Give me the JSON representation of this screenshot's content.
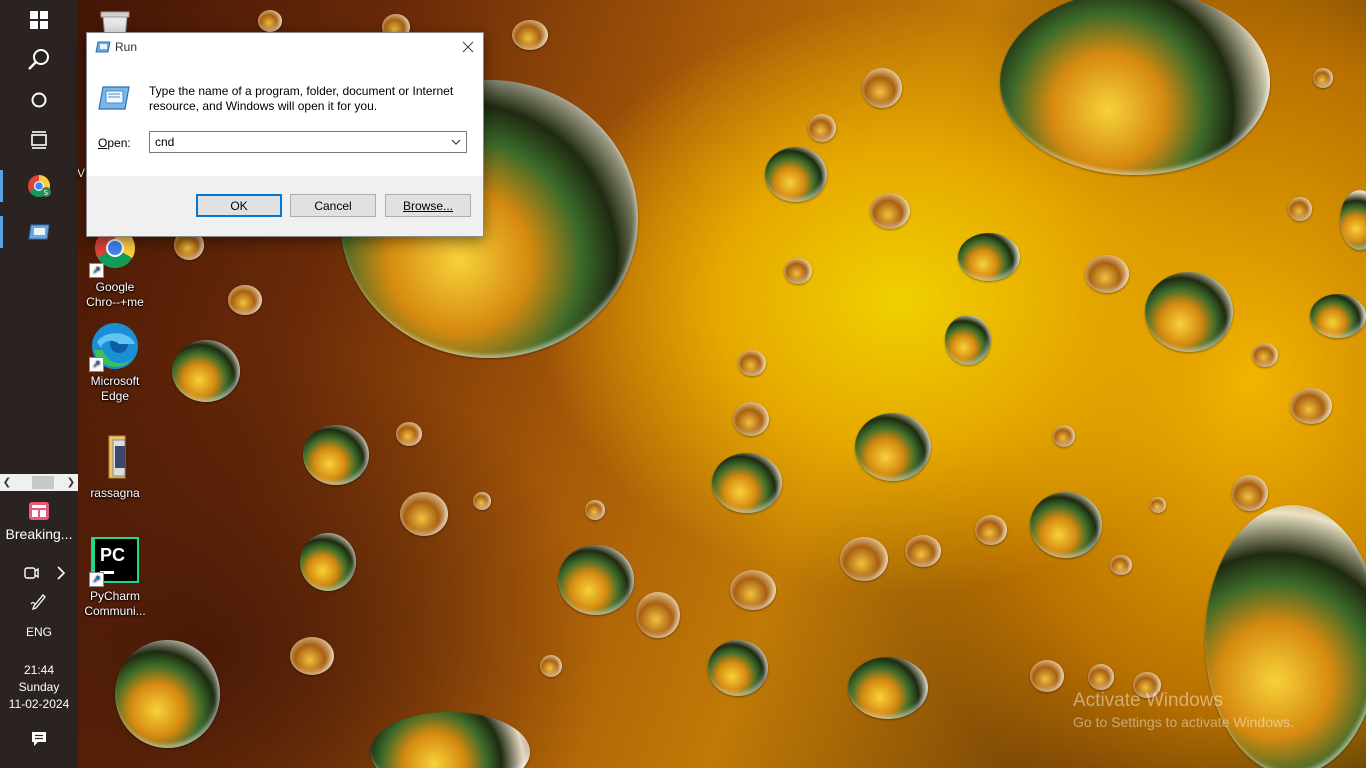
{
  "run_dialog": {
    "title": "Run",
    "description": "Type the name of a program, folder, document or Internet resource, and Windows will open it for you.",
    "open_label_prefix": "O",
    "open_label_rest": "pen:",
    "open_value": "cnd",
    "buttons": {
      "ok": "OK",
      "cancel": "Cancel",
      "browse": "Browse..."
    }
  },
  "taskbar": {
    "news_label": "Breaking...",
    "language": "ENG",
    "time": "21:44",
    "day": "Sunday",
    "date": "11-02-2024"
  },
  "desktop_icons": [
    {
      "label_line1": "Google",
      "label_line2": "Chro--+me"
    },
    {
      "label_line1": "Microsoft",
      "label_line2": "Edge"
    },
    {
      "label_line1": "rassagna",
      "label_line2": ""
    },
    {
      "label_line1": "PyCharm",
      "label_line2": "Communi..."
    }
  ],
  "partial_desktop_label": "V",
  "watermark": {
    "line1": "Activate Windows",
    "line2": "Go to Settings to activate Windows."
  },
  "colors": {
    "taskbar_bg": "#2b2322",
    "accent": "#0078d7",
    "active_indicator": "#5aa0e8"
  }
}
